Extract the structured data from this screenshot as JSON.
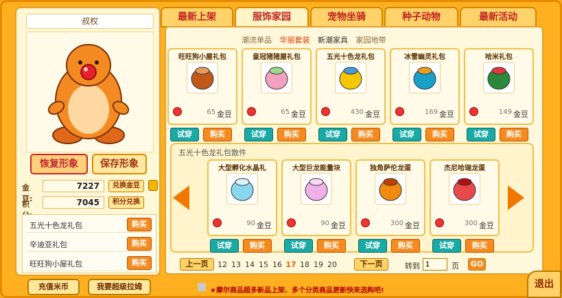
{
  "pet_name": "叔权",
  "shape_buttons": {
    "restore": "恢复形象",
    "save": "保存形象"
  },
  "stats": {
    "gold_label": "金豆:",
    "gold_value": "7227",
    "gold_button": "兑换金豆",
    "points_label": "积分:",
    "points_value": "7045",
    "points_button": "积分兑换"
  },
  "cart": [
    {
      "name": "五光十色龙礼包",
      "buy": "购买"
    },
    {
      "name": "辛迪亚礼包",
      "buy": "购买"
    },
    {
      "name": "旺旺狗小屋礼包",
      "buy": "购买"
    }
  ],
  "tabs": [
    {
      "label": "最新上架"
    },
    {
      "label": "服饰家园"
    },
    {
      "label": "宠物坐骑"
    },
    {
      "label": "种子动物"
    },
    {
      "label": "最新活动"
    }
  ],
  "subnav": [
    "潮流单品",
    "华丽套装",
    "新潮家具",
    "家园地带"
  ],
  "currency": "金豆",
  "try_label": "试穿",
  "buy_label": "购买",
  "top_items": [
    {
      "name": "旺旺狗小屋礼包",
      "price": "65"
    },
    {
      "name": "皇冠猪猪屋礼包",
      "price": "65"
    },
    {
      "name": "五光十色龙礼包",
      "price": "430"
    },
    {
      "name": "冰雪幽灵礼包",
      "price": "169"
    },
    {
      "name": "哈米礼包",
      "price": "149"
    }
  ],
  "parts_title": "五光十色龙礼包散件",
  "part_items": [
    {
      "name": "大型孵化水晶礼",
      "price": "90"
    },
    {
      "name": "大型巨龙能量块",
      "price": "90"
    },
    {
      "name": "独角萨伦龙蛋",
      "price": "300"
    },
    {
      "name": "杰尼哈瑞龙蛋",
      "price": "300"
    }
  ],
  "pager": {
    "prev": "上一页",
    "next": "下一页",
    "pages": [
      "12",
      "13",
      "14",
      "15",
      "16",
      "17",
      "18",
      "19",
      "20"
    ],
    "current": "17",
    "goto_label": "转到",
    "goto_value": "1",
    "page_unit": "页",
    "go": "GO"
  },
  "bottom": {
    "recharge": "充值米币",
    "super_lahm": "我要超级拉姆",
    "marquee": "★摩尔商品超多新品上架、多个分类商品更新快来选购吧!",
    "exit": "退出"
  }
}
